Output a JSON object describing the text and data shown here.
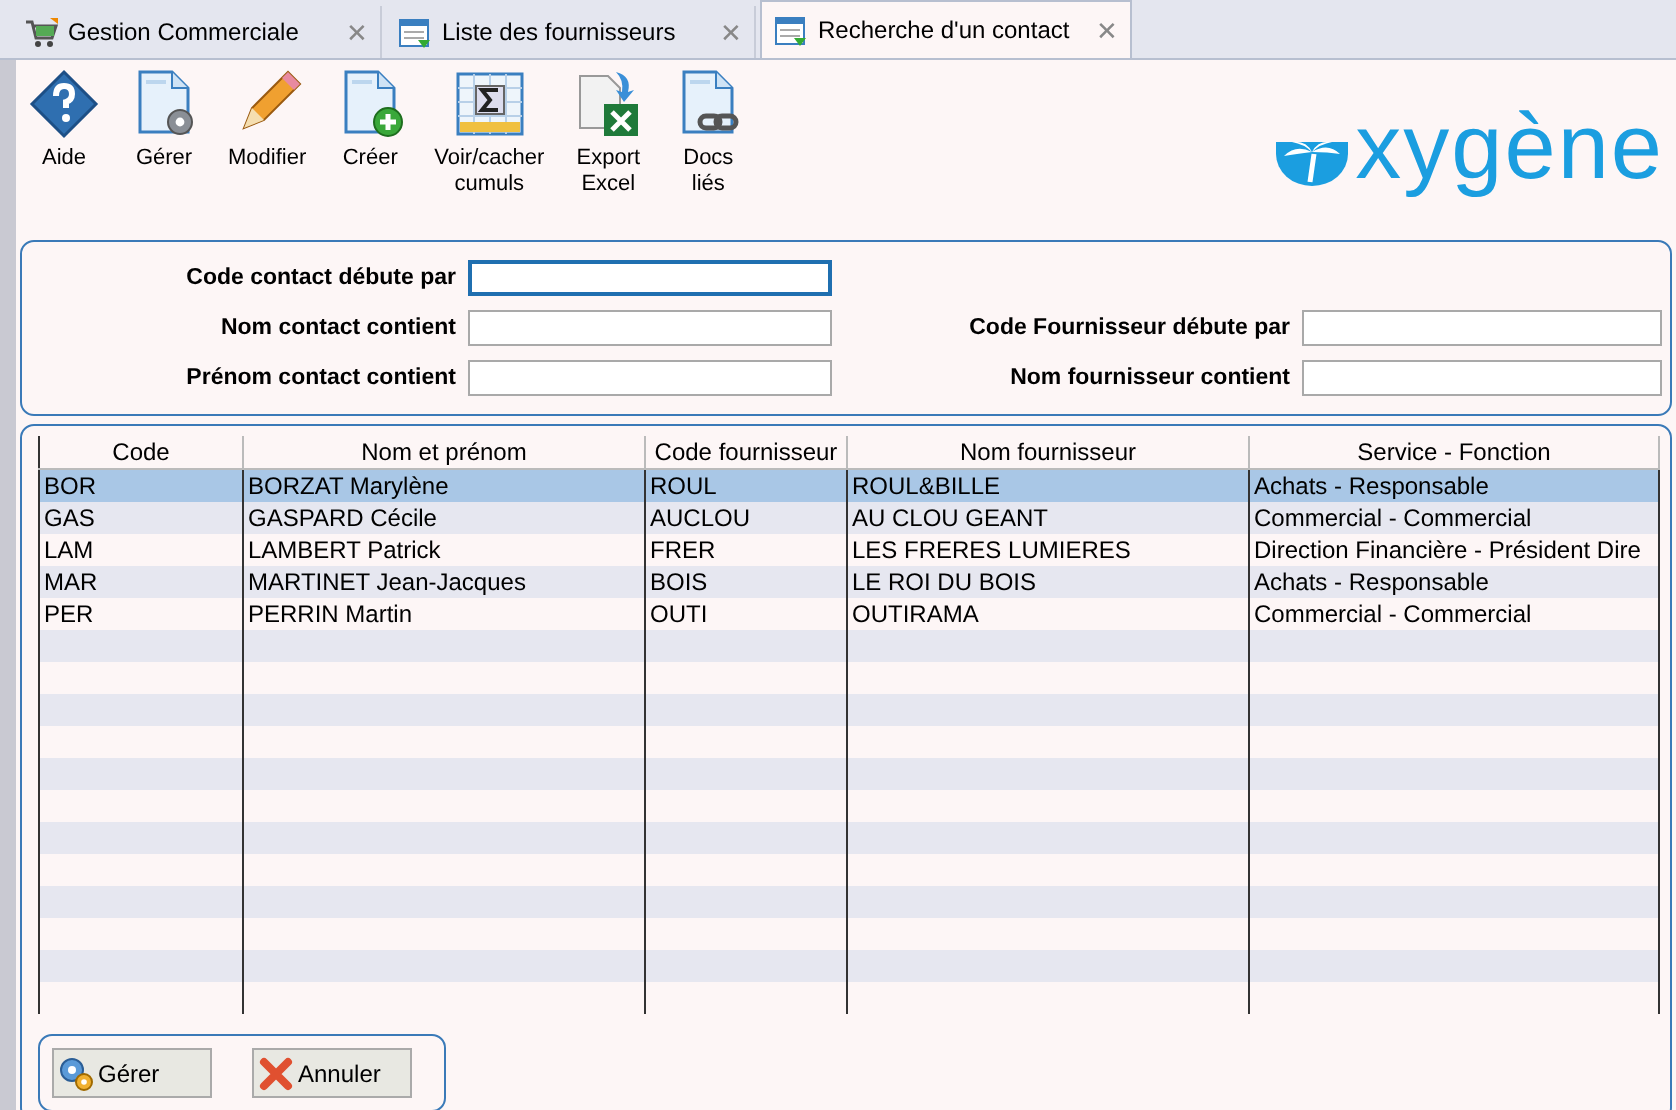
{
  "tabs": [
    {
      "label": "Gestion Commerciale",
      "kind": "cart",
      "selected": false,
      "close": "✕"
    },
    {
      "label": "Liste des fournisseurs",
      "kind": "list",
      "selected": false,
      "close": "✕"
    },
    {
      "label": "Recherche d'un contact",
      "kind": "list",
      "selected": true,
      "close": "✕"
    }
  ],
  "toolbar": [
    {
      "label": "Aide",
      "kind": "help"
    },
    {
      "label": "Gérer",
      "kind": "gear-doc"
    },
    {
      "label": "Modifier",
      "kind": "pencil"
    },
    {
      "label": "Créer",
      "kind": "plus-doc"
    },
    {
      "label": "Voir/cacher cumuls",
      "kind": "sigma"
    },
    {
      "label": "Export Excel",
      "kind": "excel"
    },
    {
      "label": "Docs liés",
      "kind": "link-doc"
    }
  ],
  "logo": {
    "text": "xygène"
  },
  "search": {
    "left": [
      {
        "label": "Code contact débute par",
        "focused": true
      },
      {
        "label": "Nom contact contient",
        "focused": false
      },
      {
        "label": "Prénom contact contient",
        "focused": false
      }
    ],
    "right": [
      {
        "label": "Code Fournisseur débute par",
        "focused": false
      },
      {
        "label": "Nom fournisseur contient",
        "focused": false
      }
    ]
  },
  "table": {
    "columns": [
      "Code",
      "Nom et prénom",
      "Code fournisseur",
      "Nom fournisseur",
      "Service - Fonction"
    ],
    "rows": [
      {
        "cells": [
          "BOR",
          "BORZAT Marylène",
          "ROUL",
          "ROUL&BILLE",
          "Achats - Responsable"
        ],
        "selected": true
      },
      {
        "cells": [
          "GAS",
          "GASPARD Cécile",
          "AUCLOU",
          "AU CLOU GEANT",
          "Commercial - Commercial"
        ],
        "selected": false
      },
      {
        "cells": [
          "LAM",
          "LAMBERT Patrick",
          "FRER",
          "LES FRERES LUMIERES",
          "Direction Financière - Président Dire"
        ],
        "selected": false
      },
      {
        "cells": [
          "MAR",
          "MARTINET Jean-Jacques",
          "BOIS",
          "LE ROI DU BOIS",
          "Achats - Responsable"
        ],
        "selected": false
      },
      {
        "cells": [
          "PER",
          "PERRIN Martin",
          "OUTI",
          "OUTIRAMA",
          "Commercial - Commercial"
        ],
        "selected": false
      }
    ]
  },
  "buttons": [
    {
      "label": "Gérer",
      "kind": "gears"
    },
    {
      "label": "Annuler",
      "kind": "cross"
    }
  ]
}
